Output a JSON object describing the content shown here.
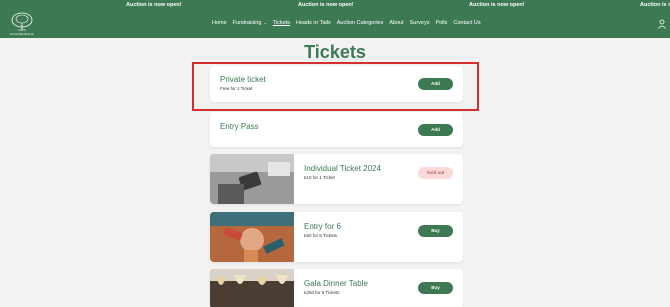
{
  "announcement": {
    "text": "Auction is now open!",
    "colors": {
      "bar": "#3d7a53",
      "text": "#ffffff"
    }
  },
  "header": {
    "brand": "SCHOENDALE",
    "nav": [
      {
        "label": "Home"
      },
      {
        "label": "Fundraising",
        "has_dropdown": true
      },
      {
        "label": "Tickets",
        "active": true
      },
      {
        "label": "Heads or Tails"
      },
      {
        "label": "Auction Categories"
      },
      {
        "label": "About"
      },
      {
        "label": "Surveys"
      },
      {
        "label": "Polls"
      },
      {
        "label": "Contact Us"
      }
    ],
    "account_icon": "user-icon"
  },
  "page": {
    "title": "Tickets"
  },
  "tickets": [
    {
      "title": "Private ticket",
      "subtitle": "Free for 1 Ticket",
      "button": "Add",
      "status": "available",
      "highlighted": true
    },
    {
      "title": "Entry Pass",
      "subtitle": "",
      "button": "Add",
      "status": "available"
    },
    {
      "title": "Individual Ticket 2024",
      "subtitle": "£10 for 1 Ticket",
      "button": "Sold out",
      "status": "sold-out",
      "image": "phone-photo"
    },
    {
      "title": "Entry for 6",
      "subtitle": "£50 for 6 Tickets",
      "button": "Buy",
      "status": "available",
      "image": "hands-photo"
    },
    {
      "title": "Gala Dinner Table",
      "subtitle": "£250 for 6 Tickets",
      "button": "Buy",
      "status": "available",
      "image": "wine-glasses-photo"
    }
  ],
  "theme": {
    "accent": "#3d7a53",
    "sold_out_bg": "#fbd9d9",
    "sold_out_text": "#c26565",
    "highlight": "#d32f2f"
  }
}
